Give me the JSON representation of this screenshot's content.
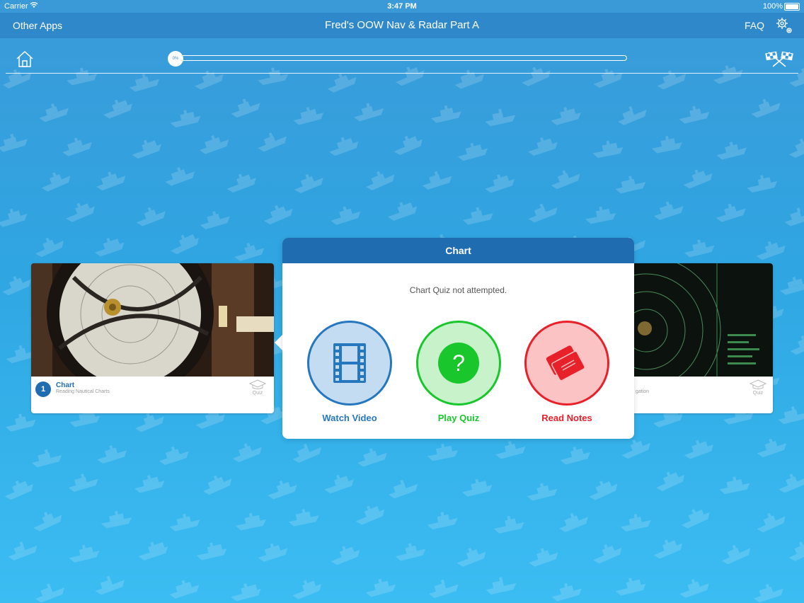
{
  "status_bar": {
    "carrier": "Carrier",
    "time": "3:47 PM",
    "battery": "100%"
  },
  "nav": {
    "left": "Other Apps",
    "title": "Fred's OOW Nav & Radar Part A",
    "faq": "FAQ"
  },
  "progress": {
    "percent_label": "0%",
    "value": 0
  },
  "cards": [
    {
      "number": "1",
      "title": "Chart",
      "subtitle": "Reading Nautical Charts",
      "quiz_label": "Quiz"
    },
    {
      "subtitle": "gation",
      "quiz_label": "Quiz"
    }
  ],
  "popover": {
    "title": "Chart",
    "status": "Chart Quiz not attempted.",
    "actions": [
      {
        "label": "Watch Video",
        "color": "#2677bd"
      },
      {
        "label": "Play Quiz",
        "color": "#19c72c"
      },
      {
        "label": "Read Notes",
        "color": "#e8202a"
      }
    ]
  },
  "icons": [
    "wifi-icon",
    "gear-icon",
    "home-icon",
    "finish-flags-icon",
    "graduation-cap-icon",
    "film-icon",
    "question-icon",
    "notes-cards-icon"
  ]
}
